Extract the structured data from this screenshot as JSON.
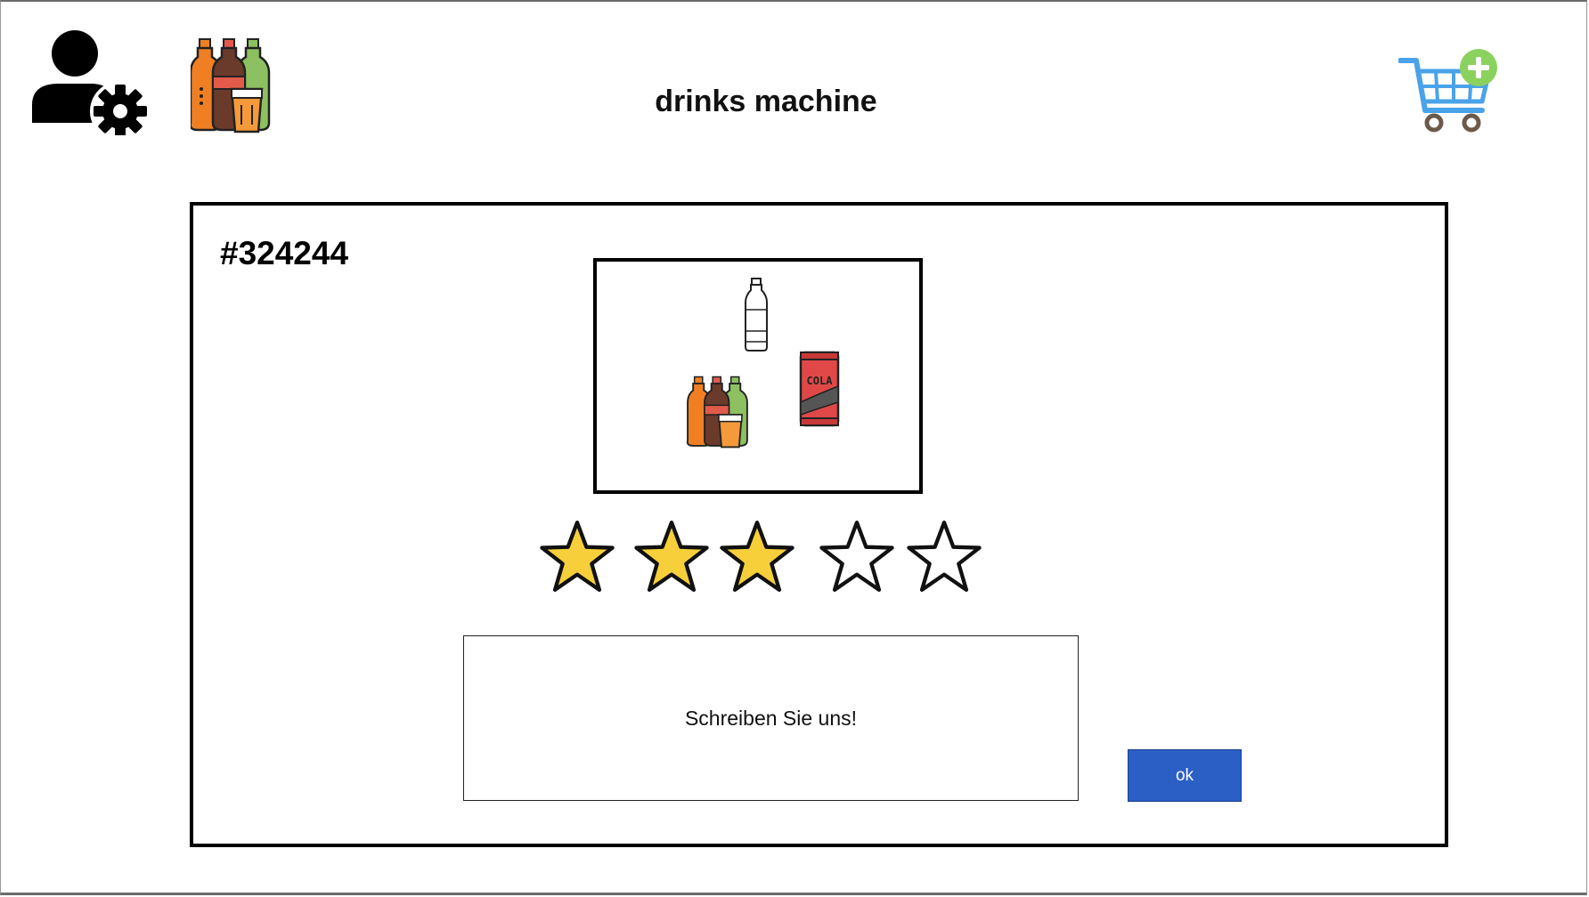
{
  "header": {
    "title": "drinks machine",
    "user_settings_icon": "user-settings-icon",
    "drinks_logo_icon": "drinks-bottles-icon",
    "cart_icon": "cart-add-icon"
  },
  "order": {
    "id": "#324244",
    "products": [
      "water-bottle-icon",
      "soda-bottles-icon",
      "cola-can-icon"
    ],
    "can_label": "COLA"
  },
  "rating": {
    "value": 3,
    "max": 5,
    "filled_color": "#f7cf3a",
    "empty_color": "#ffffff"
  },
  "feedback": {
    "placeholder": "Schreiben Sie uns!"
  },
  "actions": {
    "ok_label": "ok",
    "ok_color": "#2b5fc6"
  }
}
